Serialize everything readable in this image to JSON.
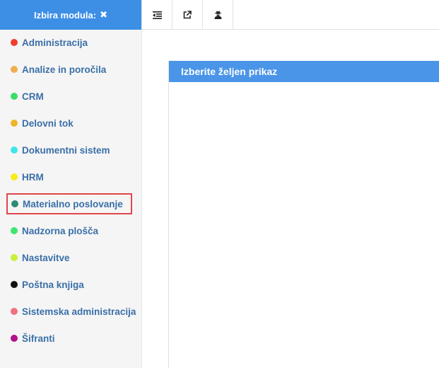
{
  "sidebar": {
    "header_label": "Izbira modula:",
    "close_glyph": "✖",
    "items": [
      {
        "label": "Administracija",
        "color": "#f03c2e"
      },
      {
        "label": "Analize in poročila",
        "color": "#f0ad4e"
      },
      {
        "label": "CRM",
        "color": "#3ddc6a"
      },
      {
        "label": "Delovni tok",
        "color": "#f0b429"
      },
      {
        "label": "Dokumentni sistem",
        "color": "#3ee6ea"
      },
      {
        "label": "HRM",
        "color": "#f5ed1c"
      },
      {
        "label": "Materialno poslovanje",
        "color": "#2e8b74"
      },
      {
        "label": "Nadzorna plošča",
        "color": "#3ee66e"
      },
      {
        "label": "Nastavitve",
        "color": "#c6f03a"
      },
      {
        "label": "Poštna knjiga",
        "color": "#111111"
      },
      {
        "label": "Sistemska administracija",
        "color": "#f07082"
      },
      {
        "label": "Šifranti",
        "color": "#b0128c"
      }
    ],
    "selected_index": 6
  },
  "toolbar": {
    "buttons": [
      {
        "icon": "outdent-icon"
      },
      {
        "icon": "external-link-icon"
      },
      {
        "icon": "user-secret-icon"
      }
    ]
  },
  "panel": {
    "title": "Izberite željen prikaz"
  },
  "colors": {
    "header_blue": "#3d8fe6",
    "panel_blue": "#4a95e8",
    "label_blue": "#3a6fa8",
    "highlight_red": "#e0464b"
  }
}
